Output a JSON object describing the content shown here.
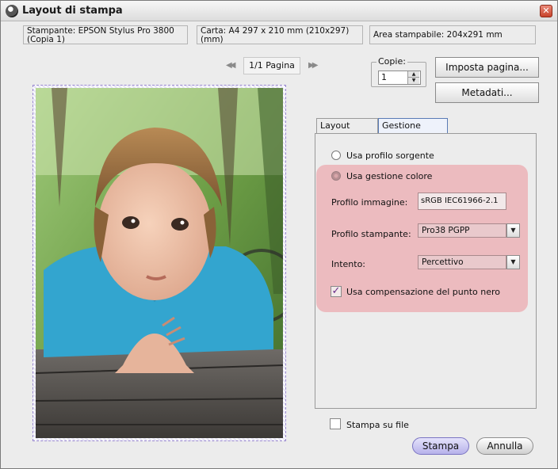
{
  "window": {
    "title": "Layout di stampa",
    "close_label": "✕"
  },
  "info": {
    "printer_line1": "Stampante:  EPSON Stylus Pro 3800",
    "printer_line2": "(Copia 1)",
    "paper_line1": "Carta:  A4 297 x 210 mm (210x297)",
    "paper_line2": "(mm)",
    "printable_area": "Area stampabile:  204x291 mm"
  },
  "pager": {
    "prev_icon": "◀◀",
    "next_icon": "▶▶",
    "page_label": "1/1 Pagina"
  },
  "copies": {
    "label": "Copie:",
    "value": "1",
    "spin_up_icon": "▲",
    "spin_down_icon": "▼"
  },
  "buttons": {
    "page_setup": "Imposta pagina...",
    "metadata": "Metadati...",
    "print": "Stampa",
    "cancel": "Annulla"
  },
  "tabs": [
    {
      "label": "Layout pagina"
    },
    {
      "label": "Gestione colore"
    }
  ],
  "color": {
    "use_source_profile": "Usa profilo sorgente",
    "use_color_management": "Usa gestione colore",
    "image_profile_label": "Profilo immagine:",
    "image_profile_value": "sRGB IEC61966-2.1",
    "printer_profile_label": "Profilo stampante:",
    "printer_profile_value": "Pro38 PGPP",
    "intent_label": "Intento:",
    "intent_value": "Percettivo",
    "black_point_label": "Usa compensazione del punto nero",
    "black_point_checked": true
  },
  "print_to_file": {
    "label": "Stampa su file",
    "checked": false
  },
  "icons": {
    "dropdown_arrow": "▼",
    "check_mark": "✓"
  },
  "colors": {
    "color_group_bg": "#ecbbbf",
    "print_button": "#c9c6ee"
  }
}
